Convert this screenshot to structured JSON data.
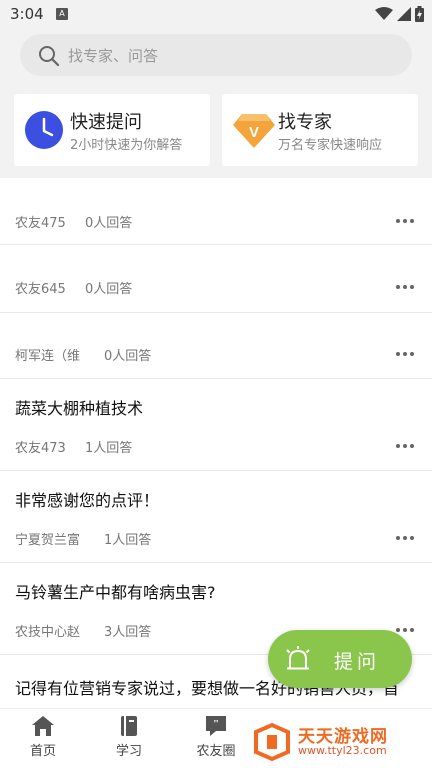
{
  "status_bar": {
    "time": "3:04",
    "notification_icon": "A"
  },
  "search": {
    "placeholder": "找专家、问答"
  },
  "cards": {
    "quick": {
      "title": "快速提问",
      "subtitle": "2小时快速为你解答",
      "icon": "clock-icon"
    },
    "expert": {
      "title": "找专家",
      "subtitle": "万名专家快速响应",
      "icon": "diamond-v-icon"
    }
  },
  "feed": [
    {
      "title": "",
      "author": "农友475",
      "answers": "0人回答"
    },
    {
      "title": "",
      "author": "农友645",
      "answers": "0人回答"
    },
    {
      "title": "",
      "author": "柯军连（维",
      "answers": "0人回答"
    },
    {
      "title": "蔬菜大棚种植技术",
      "author": "农友473",
      "answers": "1人回答"
    },
    {
      "title": "非常感谢您的点评！",
      "author": "宁夏贺兰富",
      "answers": "1人回答"
    },
    {
      "title": "马铃薯生产中都有啥病虫害?",
      "author": "农技中心赵",
      "answers": "3人回答"
    },
    {
      "title": "记得有位营销专家说过，要想做一名好的销售人员，首",
      "author": "",
      "answers": ""
    }
  ],
  "fab": {
    "label": "提问",
    "icon": "alarm-bell-icon"
  },
  "tabs": [
    {
      "label": "首页",
      "icon": "home-icon"
    },
    {
      "label": "学习",
      "icon": "book-icon"
    },
    {
      "label": "农友圈",
      "icon": "chat-bubble-icon"
    }
  ],
  "watermark": {
    "title": "天天游戏网",
    "url": "www.ttyl23.com"
  },
  "colors": {
    "accent_green": "#8bc64c",
    "watermark_orange": "#f06a22",
    "clock_blue": "#3b4fe0",
    "diamond_orange": "#f4a43a"
  }
}
